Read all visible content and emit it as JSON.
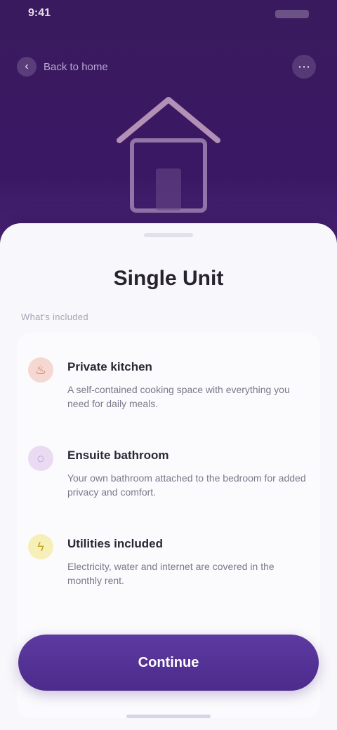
{
  "status_bar": {
    "time": "9:41"
  },
  "top_bar": {
    "back_label": "Back to home",
    "menu_icon": "more-icon"
  },
  "hero": {
    "illustration": "house-icon"
  },
  "sheet": {
    "title": "Single Unit",
    "section_label": "What's included",
    "items": [
      {
        "title": "Private kitchen",
        "description": "A self-contained cooking space with everything you need for daily meals.",
        "icon": "kitchen-icon",
        "icon_bg": "#f6d8d2",
        "icon_color": "#c96b55"
      },
      {
        "title": "Ensuite bathroom",
        "description": "Your own bathroom attached to the bedroom for added privacy and comfort.",
        "icon": "bath-icon",
        "icon_bg": "#eadbf3",
        "icon_color": "#9c6bbd"
      },
      {
        "title": "Utilities included",
        "description": "Electricity, water and internet are covered in the monthly rent.",
        "icon": "bolt-icon",
        "icon_bg": "#f7efb8",
        "icon_color": "#c7a724"
      }
    ]
  },
  "cta": {
    "label": "Continue"
  },
  "colors": {
    "hero": "#3b1864",
    "accent": "#5d3aa0",
    "sheet": "#f8f7fb"
  }
}
